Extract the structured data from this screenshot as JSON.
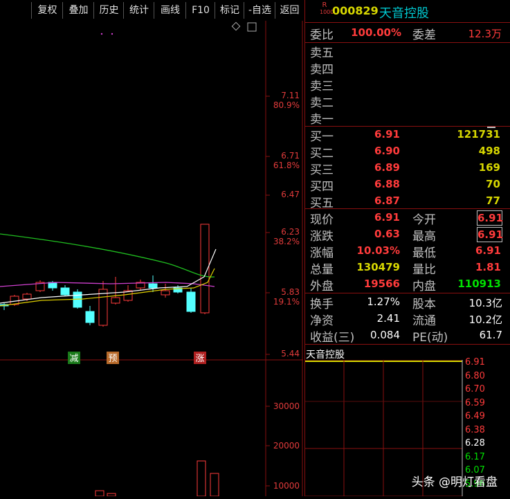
{
  "toolbar": {
    "items": [
      "复权",
      "叠加",
      "历史",
      "统计",
      "画线",
      "F10",
      "标记",
      "-自选",
      "返回"
    ]
  },
  "chart": {
    "price_labels": [
      {
        "price": "7.11",
        "pct": "80.9%"
      },
      {
        "price": "6.71",
        "pct": "61.8%"
      },
      {
        "price": "6.47",
        "pct": ""
      },
      {
        "price": "6.23",
        "pct": "38.2%"
      },
      {
        "price": "5.83",
        "pct": "19.1%"
      },
      {
        "price": "5.44",
        "pct": ""
      }
    ],
    "volume_labels": [
      "30000",
      "20000",
      "10000"
    ],
    "badges": [
      {
        "text": "减",
        "color": "#1a7a1a"
      },
      {
        "text": "预",
        "color": "#b86a2a"
      },
      {
        "text": "涨",
        "color": "#b02020"
      }
    ]
  },
  "header": {
    "r_top": "R",
    "r_bottom": "1000",
    "code": "000829",
    "name": "天音控股"
  },
  "weibi": {
    "label": "委比",
    "value": "100.00%",
    "diff_label": "委差",
    "diff_value": "12.3万"
  },
  "sell": [
    "卖五",
    "卖四",
    "卖三",
    "卖二",
    "卖一"
  ],
  "buy": [
    {
      "label": "买一",
      "price": "6.91",
      "vol": "121731"
    },
    {
      "label": "买二",
      "price": "6.90",
      "vol": "498"
    },
    {
      "label": "买三",
      "price": "6.89",
      "vol": "169"
    },
    {
      "label": "买四",
      "price": "6.88",
      "vol": "70"
    },
    {
      "label": "买五",
      "price": "6.87",
      "vol": "77"
    }
  ],
  "quote": [
    {
      "l1": "现价",
      "v1": "6.91",
      "c1": "red",
      "l2": "今开",
      "v2": "6.91",
      "c2": "red",
      "box": true
    },
    {
      "l1": "涨跌",
      "v1": "0.63",
      "c1": "red",
      "l2": "最高",
      "v2": "6.91",
      "c2": "red",
      "box": true
    },
    {
      "l1": "涨幅",
      "v1": "10.03%",
      "c1": "red",
      "l2": "最低",
      "v2": "6.91",
      "c2": "red",
      "box": false
    },
    {
      "l1": "总量",
      "v1": "130479",
      "c1": "yel",
      "l2": "量比",
      "v2": "1.81",
      "c2": "red",
      "box": false
    },
    {
      "l1": "外盘",
      "v1": "19566",
      "c1": "red",
      "l2": "内盘",
      "v2": "110913",
      "c2": "grn",
      "box": false
    }
  ],
  "finance": [
    {
      "l1": "换手",
      "v1": "1.27%",
      "l2": "股本",
      "v2": "10.3亿"
    },
    {
      "l1": "净资",
      "v1": "2.41",
      "l2": "流通",
      "v2": "10.2亿"
    },
    {
      "l1": "收益(三)",
      "v1": "0.084",
      "l2": "PE(动)",
      "v2": "61.7"
    }
  ],
  "mini": {
    "title": "天音控股",
    "axis": [
      {
        "v": "6.91",
        "c": "#ff3b3b"
      },
      {
        "v": "6.80",
        "c": "#ff3b3b"
      },
      {
        "v": "6.70",
        "c": "#ff3b3b"
      },
      {
        "v": "6.59",
        "c": "#ff3b3b"
      },
      {
        "v": "6.49",
        "c": "#ff3b3b"
      },
      {
        "v": "6.38",
        "c": "#ff3b3b"
      },
      {
        "v": "6.28",
        "c": "#ffffff"
      },
      {
        "v": "6.17",
        "c": "#00e000"
      },
      {
        "v": "6.07",
        "c": "#00e000"
      },
      {
        "v": "5.96",
        "c": "#00e000"
      }
    ]
  },
  "watermark": "头条 @明灯看盘"
}
